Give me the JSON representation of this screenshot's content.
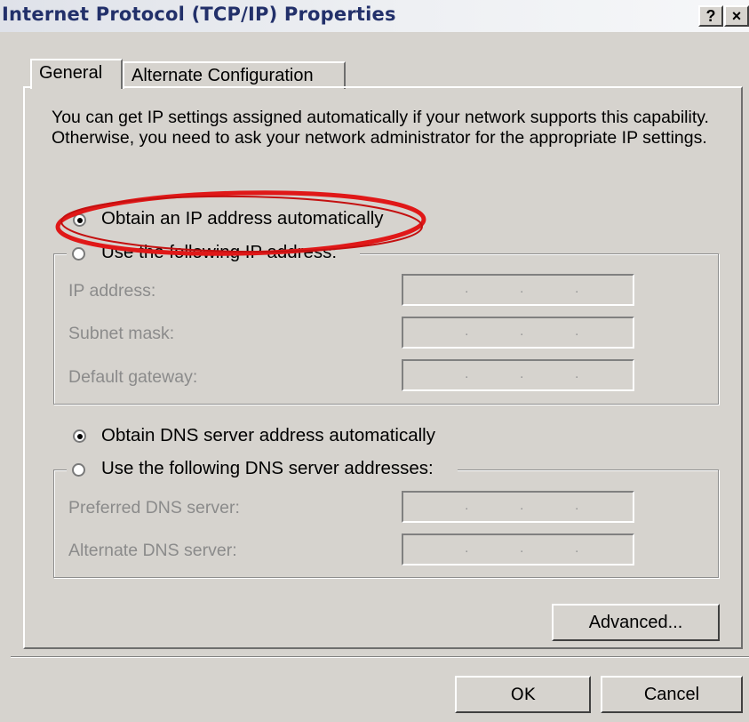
{
  "window": {
    "title": "Internet Protocol (TCP/IP) Properties",
    "help_button": "?",
    "close_button": "×"
  },
  "tabs": [
    {
      "label": "General"
    },
    {
      "label": "Alternate Configuration"
    }
  ],
  "description": "You can get IP settings assigned automatically if your network supports this capability. Otherwise, you need to ask your network administrator for the appropriate IP settings.",
  "ip_section": {
    "auto_option": "Obtain an IP address automatically",
    "manual_option": "Use the following IP address:",
    "selected": "auto",
    "fields": [
      {
        "label": "IP address:",
        "value": ""
      },
      {
        "label": "Subnet mask:",
        "value": ""
      },
      {
        "label": "Default gateway:",
        "value": ""
      }
    ]
  },
  "dns_section": {
    "auto_option": "Obtain DNS server address automatically",
    "manual_option": "Use the following DNS server addresses:",
    "selected": "auto",
    "fields": [
      {
        "label": "Preferred DNS server:",
        "value": ""
      },
      {
        "label": "Alternate DNS server:",
        "value": ""
      }
    ]
  },
  "buttons": {
    "advanced": "Advanced...",
    "ok": "OK",
    "cancel": "Cancel"
  },
  "colors": {
    "dialog_bg": "#d6d3ce",
    "title_text": "#22306a",
    "annotation_ring": "#e01818",
    "disabled_text": "#8b8b8b"
  }
}
